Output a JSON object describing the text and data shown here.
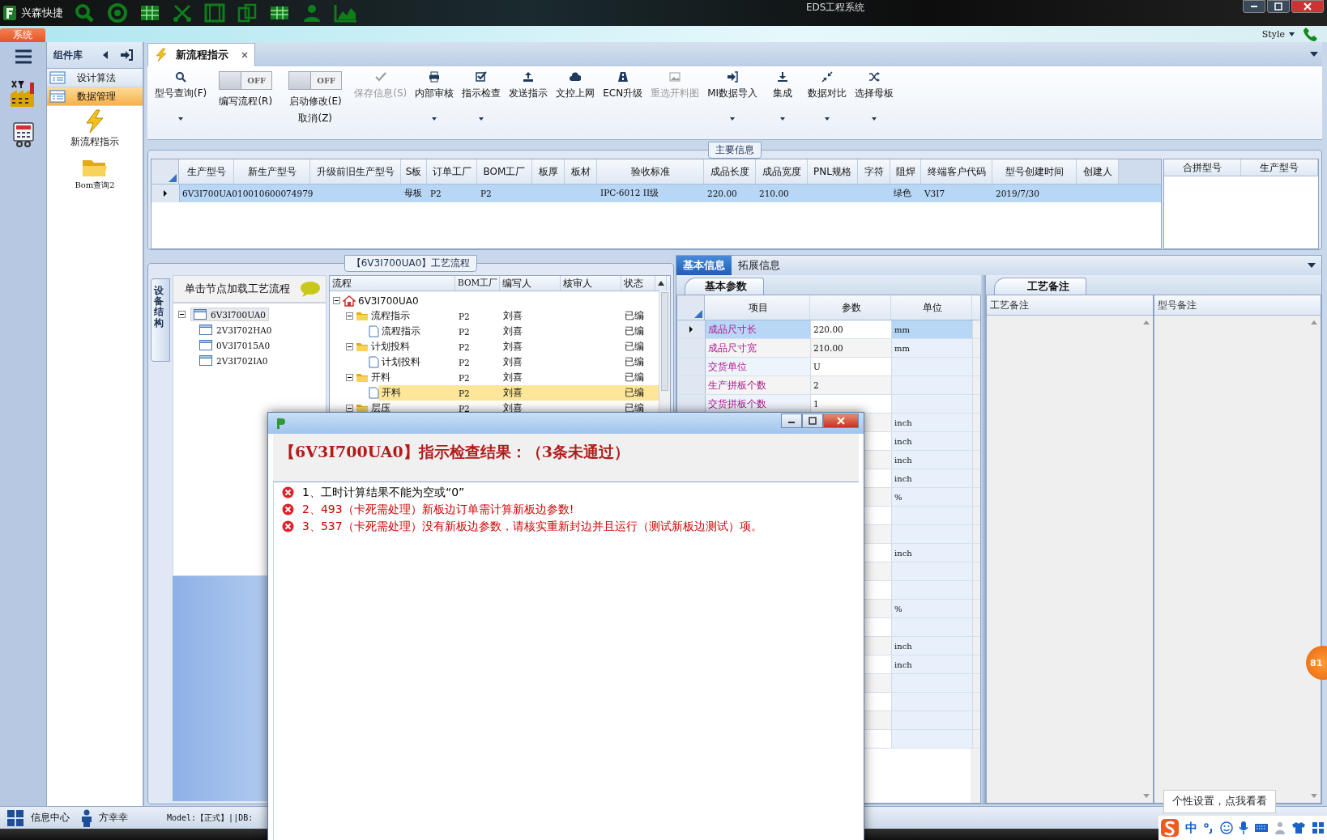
{
  "window": {
    "app_name": "兴森快捷",
    "title": "EDS工程系统"
  },
  "menu": {
    "tabs": [
      {
        "label": "系统",
        "selected": true
      }
    ],
    "style_label": "Style"
  },
  "side_nav": {
    "title": "组件库",
    "items": [
      {
        "label": "设计算法",
        "selected": false
      },
      {
        "label": "数据管理",
        "selected": true
      }
    ],
    "modules": [
      {
        "label": "新流程指示",
        "kind": "lightning"
      },
      {
        "label": "Bom查询2",
        "kind": "folder"
      }
    ]
  },
  "doc_tab": {
    "label": "新流程指示"
  },
  "toolbar": [
    {
      "kind": "button",
      "label": "型号查询(F)",
      "dropdown": true,
      "disabled": false
    },
    {
      "kind": "toggle",
      "label": "编写流程(R)",
      "toggle_text": "OFF",
      "on": false
    },
    {
      "kind": "toggle",
      "label": "启动修改(E)",
      "sublabel": "取消(Z)",
      "toggle_text": "OFF",
      "on": false
    },
    {
      "kind": "button",
      "label": "保存信息(S)",
      "dropdown": false,
      "disabled": true
    },
    {
      "kind": "button",
      "label": "内部审核",
      "dropdown": true,
      "disabled": false
    },
    {
      "kind": "button",
      "label": "指示检查",
      "dropdown": true,
      "disabled": false
    },
    {
      "kind": "button",
      "label": "发送指示",
      "dropdown": false,
      "disabled": false
    },
    {
      "kind": "button",
      "label": "文控上网",
      "dropdown": false,
      "disabled": false
    },
    {
      "kind": "button",
      "label": "ECN升级",
      "dropdown": false,
      "disabled": false
    },
    {
      "kind": "button",
      "label": "重选开料图",
      "dropdown": false,
      "disabled": true
    },
    {
      "kind": "button",
      "label": "MI数据导入",
      "dropdown": true,
      "disabled": false
    },
    {
      "kind": "button",
      "label": "集成",
      "dropdown": true,
      "disabled": false
    },
    {
      "kind": "button",
      "label": "数据对比",
      "dropdown": true,
      "disabled": false
    },
    {
      "kind": "button",
      "label": "选择母板",
      "dropdown": true,
      "disabled": false
    }
  ],
  "main_info": {
    "title": "主要信息",
    "columns": [
      "生产型号",
      "新生产型号",
      "升级前旧生产型号",
      "S板",
      "订单工厂",
      "BOM工厂",
      "板厚",
      "板材",
      "验收标准",
      "成品长度",
      "成品宽度",
      "PNL规格",
      "字符",
      "阻焊",
      "终端客户代码",
      "型号创建时间",
      "创建人"
    ],
    "rows": [
      {
        "selected": true,
        "cells": [
          "6V3I700UA0",
          "10010600074979",
          null,
          "母板",
          "P2",
          "P2",
          null,
          null,
          "IPC-6012 II级",
          "220.00",
          "210.00",
          null,
          null,
          "绿色",
          "V3I7",
          "2019/7/30",
          null
        ]
      }
    ],
    "side_columns": [
      "合拼型号",
      "生产型号"
    ]
  },
  "process": {
    "title": "【6V3I700UA0】工艺流程",
    "side_tab": "设备结构",
    "hint": "单击节点加载工艺流程",
    "structure_tree": [
      {
        "label": "6V3I700UA0",
        "selected": true,
        "expanded": true,
        "children": [
          {
            "label": "2V3I702HA0",
            "selected": false
          },
          {
            "label": "0V3I7015A0",
            "selected": false
          },
          {
            "label": "2V3I702IA0",
            "selected": false
          }
        ]
      }
    ],
    "flow_columns": [
      "流程",
      "BOM工厂",
      "编写人",
      "核审人",
      "状态"
    ],
    "flow_tree": [
      {
        "label": "6V3I700UA0",
        "kind": "root",
        "expanded": true,
        "selected": false,
        "children": [
          {
            "label": "流程指示",
            "kind": "folder",
            "expanded": true,
            "selected": false,
            "bom": "P2",
            "writer": "刘喜",
            "status": "已编",
            "children": [
              {
                "label": "流程指示",
                "kind": "doc",
                "selected": false,
                "bom": "P2",
                "writer": "刘喜",
                "status": "已编"
              }
            ]
          },
          {
            "label": "计划投料",
            "kind": "folder",
            "expanded": true,
            "selected": false,
            "bom": "P2",
            "writer": "刘喜",
            "status": "已编",
            "children": [
              {
                "label": "计划投料",
                "kind": "doc",
                "selected": false,
                "bom": "P2",
                "writer": "刘喜",
                "status": "已编"
              }
            ]
          },
          {
            "label": "开料",
            "kind": "folder",
            "expanded": true,
            "selected": false,
            "bom": "P2",
            "writer": "刘喜",
            "status": "已编",
            "children": [
              {
                "label": "开料",
                "kind": "doc",
                "selected": true,
                "bom": "P2",
                "writer": "刘喜",
                "status": "已编"
              }
            ]
          },
          {
            "label": "层压",
            "kind": "folder",
            "expanded": true,
            "selected": false,
            "bom": "P2",
            "writer": "刘喜",
            "status": "已编"
          }
        ]
      }
    ]
  },
  "detail_tabs": [
    {
      "label": "基本信息",
      "selected": true
    },
    {
      "label": "拓展信息",
      "selected": false
    }
  ],
  "params": {
    "tab": "基本参数",
    "columns": [
      "项目",
      "参数",
      "单位"
    ],
    "rows": [
      {
        "item": "成品尺寸长",
        "value": "220.00",
        "unit": "mm",
        "selected": true
      },
      {
        "item": "成品尺寸宽",
        "value": "210.00",
        "unit": "mm",
        "selected": false
      },
      {
        "item": "交货单位",
        "value": "U",
        "selected": false
      },
      {
        "item": "生产拼板个数",
        "value": "2",
        "selected": false
      },
      {
        "item": "交货拼板个数",
        "value": "1",
        "selected": false
      },
      {
        "unit": "inch",
        "selected": false
      },
      {
        "unit": "inch",
        "selected": false
      },
      {
        "unit": "inch",
        "selected": false
      },
      {
        "unit": "inch",
        "selected": false
      },
      {
        "unit": "%",
        "selected": false
      },
      {
        "selected": false
      },
      {
        "selected": false
      },
      {
        "unit": "inch",
        "selected": false
      },
      {
        "selected": false
      },
      {
        "selected": false
      },
      {
        "unit": "%",
        "selected": false
      },
      {
        "selected": false
      },
      {
        "unit": "inch",
        "selected": false
      },
      {
        "unit": "inch",
        "selected": false
      },
      {
        "selected": false
      },
      {
        "selected": false
      },
      {
        "selected": false
      },
      {
        "selected": false
      }
    ]
  },
  "notes": {
    "tab": "工艺备注",
    "columns": [
      "工艺备注",
      "型号备注"
    ]
  },
  "status_bar": {
    "info": "信息中心",
    "user": "方幸幸",
    "model": "Model:【正式】||DB:"
  },
  "dialog": {
    "title": "【6V3I700UA0】指示检查结果：（3条未通过）",
    "items": [
      {
        "text": "1、工时计算结果不能为空或“0”",
        "color": "#000000"
      },
      {
        "text": "2、493（卡死需处理）新板边订单需计算新板边参数!",
        "color": "#cc0000"
      },
      {
        "text": "3、537（卡死需处理）没有新板边参数，请核实重新封边并且运行（测试新板边测试）项。",
        "color": "#cc0000"
      }
    ]
  },
  "tray": {
    "tooltip": "个性设置，点我看看",
    "ime": "中",
    "badge": "81"
  }
}
